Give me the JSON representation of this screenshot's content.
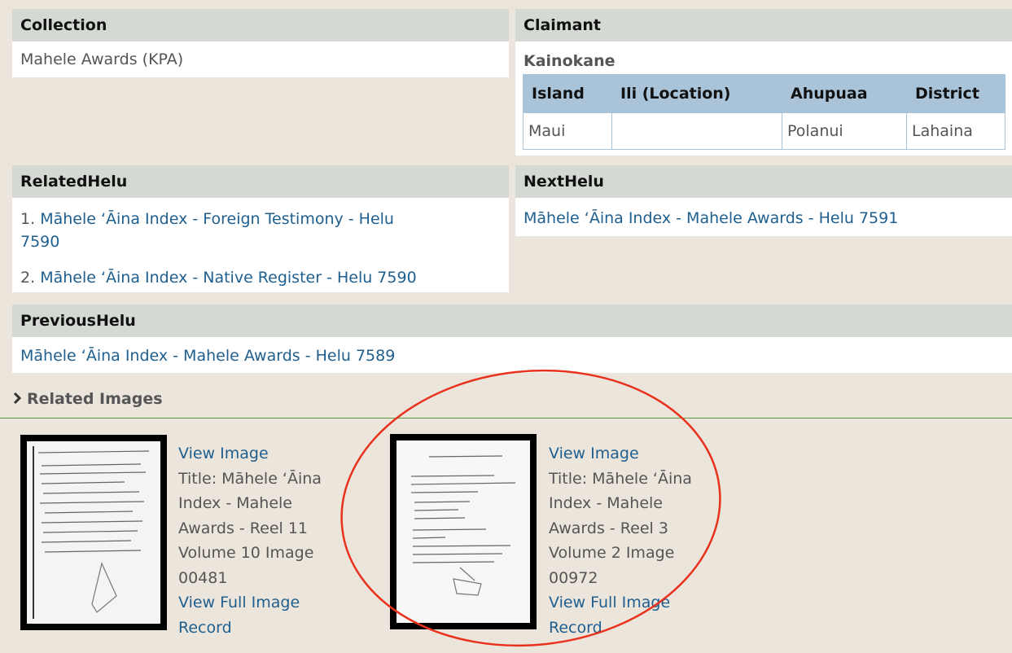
{
  "collection": {
    "heading": "Collection",
    "value": "Mahele Awards (KPA)"
  },
  "claimant": {
    "heading": "Claimant",
    "name": "Kainokane",
    "table": {
      "headers": [
        "Island",
        "Ili (Location)",
        "Ahupuaa",
        "District"
      ],
      "rows": [
        [
          "Maui",
          "",
          "Polanui",
          "Lahaina"
        ]
      ]
    }
  },
  "related_helu": {
    "heading": "RelatedHelu",
    "items": [
      {
        "num": "1.",
        "line1": "Māhele ʻĀina Index - Foreign Testimony - Helu",
        "line2": "7590"
      },
      {
        "num": "2.",
        "line1": "Māhele ʻĀina Index - Native Register - Helu 7590"
      }
    ]
  },
  "next_helu": {
    "heading": "NextHelu",
    "link": "Māhele ʻĀina Index - Mahele Awards - Helu 7591"
  },
  "previous_helu": {
    "heading": "PreviousHelu",
    "link": "Māhele ʻĀina Index - Mahele Awards - Helu 7589"
  },
  "related_images": {
    "heading": "Related Images",
    "toggle_icon": "chevron-right-icon",
    "images": [
      {
        "view_label": "View Image",
        "title_lines": [
          "Title: Māhele ʻĀina",
          "Index - Mahele",
          "Awards - Reel 11",
          "Volume 10 Image",
          "00481"
        ],
        "full_record_lines": [
          "View Full Image",
          "Record"
        ]
      },
      {
        "view_label": "View Image",
        "title_lines": [
          "Title: Māhele ʻĀina",
          "Index - Mahele",
          "Awards - Reel 3",
          "Volume 2 Image",
          "00972"
        ],
        "full_record_lines": [
          "View Full Image",
          "Record"
        ]
      }
    ]
  },
  "colors": {
    "page_background": "#ece5dc",
    "heading_background": "#d4d9d3",
    "table_header": "#a9c3d9",
    "link": "#1f5f8f",
    "divider": "#5a9a3a",
    "annotation_circle": "#e8321e"
  }
}
